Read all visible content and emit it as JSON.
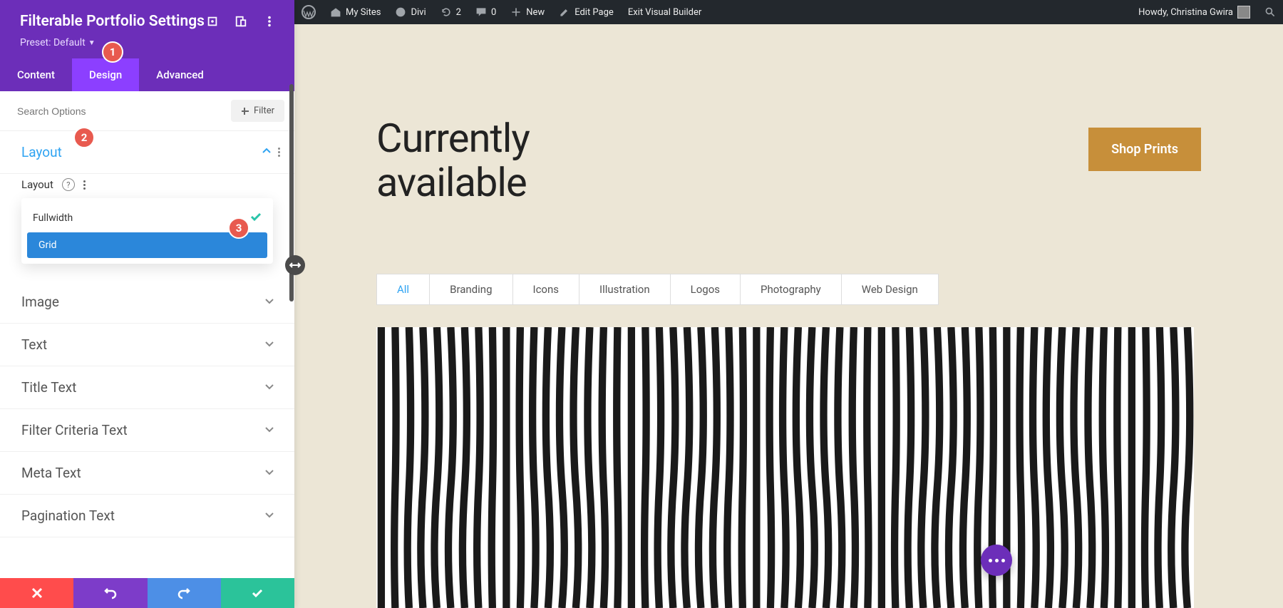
{
  "wp_bar": {
    "my_sites": "My Sites",
    "divi": "Divi",
    "refresh_count": "2",
    "comments_count": "0",
    "new": "New",
    "edit_page": "Edit Page",
    "exit_vb": "Exit Visual Builder",
    "howdy": "Howdy, Christina Gwira"
  },
  "panel": {
    "title": "Filterable Portfolio Settings",
    "preset_label": "Preset: Default",
    "tabs": {
      "content": "Content",
      "design": "Design",
      "advanced": "Advanced"
    },
    "search_placeholder": "Search Options",
    "filter_btn": "Filter",
    "sections": {
      "layout": "Layout",
      "image": "Image",
      "text": "Text",
      "title_text": "Title Text",
      "filter_criteria": "Filter Criteria Text",
      "meta_text": "Meta Text",
      "pagination_text": "Pagination Text"
    },
    "layout_field": {
      "label": "Layout",
      "options": {
        "fullwidth": "Fullwidth",
        "grid": "Grid"
      }
    }
  },
  "badges": {
    "one": "1",
    "two": "2",
    "three": "3"
  },
  "preview": {
    "heading_line1": "Currently",
    "heading_line2": "available",
    "shop_btn": "Shop Prints",
    "filters": [
      "All",
      "Branding",
      "Icons",
      "Illustration",
      "Logos",
      "Photography",
      "Web Design"
    ]
  }
}
